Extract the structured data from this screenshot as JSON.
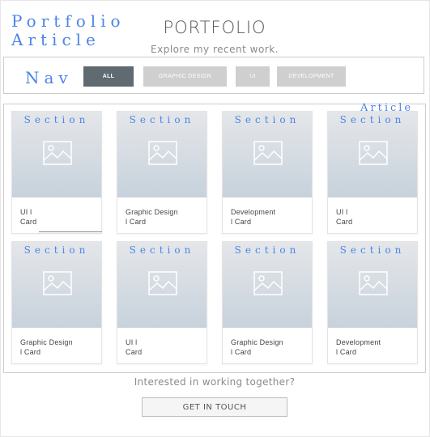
{
  "wireframe_labels": {
    "portfolio": "Portfolio",
    "article_top": "Article",
    "nav": "Nav",
    "article_right": "Article"
  },
  "header": {
    "title": "PORTFOLIO",
    "subtitle": "Explore my recent work."
  },
  "filters": [
    {
      "label": "ALL",
      "active": true
    },
    {
      "label": "GRAPHIC DESIGN",
      "active": false
    },
    {
      "label": "UI",
      "active": false
    },
    {
      "label": "DEVELOPMENT",
      "active": false
    }
  ],
  "cards": [
    {
      "section_label": "Section",
      "line1": "UI l",
      "line2": "Card",
      "icon": "image-placeholder-icon"
    },
    {
      "section_label": "Section",
      "line1": "Graphic Design",
      "line2": "l Card",
      "icon": "image-placeholder-icon"
    },
    {
      "section_label": "Section",
      "line1": "Development",
      "line2": "l Card",
      "icon": "image-placeholder-icon"
    },
    {
      "section_label": "Section",
      "line1": "UI l",
      "line2": "Card",
      "icon": "image-placeholder-icon"
    },
    {
      "section_label": "Section",
      "line1": "Graphic Design",
      "line2": "l Card",
      "icon": "image-placeholder-icon"
    },
    {
      "section_label": "Section",
      "line1": "UI l",
      "line2": "Card",
      "icon": "image-placeholder-icon"
    },
    {
      "section_label": "Section",
      "line1": "Graphic Design",
      "line2": "l Card",
      "icon": "image-placeholder-icon"
    },
    {
      "section_label": "Section",
      "line1": "Development",
      "line2": "l Card",
      "icon": "image-placeholder-icon"
    }
  ],
  "cta": {
    "text": "Interested in working together?",
    "button_label": "GET IN TOUCH"
  },
  "colors": {
    "wireframe_label": "#4a86e8",
    "active_filter": "#5f6a71",
    "inactive_filter": "#cfcfcf"
  }
}
